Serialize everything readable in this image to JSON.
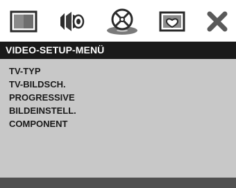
{
  "tabs": [
    {
      "icon": "tv-screen-icon"
    },
    {
      "icon": "speaker-audio-icon"
    },
    {
      "icon": "disc-icon",
      "active": true
    },
    {
      "icon": "picture-frame-icon"
    },
    {
      "icon": "close-icon"
    }
  ],
  "menu": {
    "title": "VIDEO-SETUP-MENÜ",
    "items": [
      "TV-TYP",
      "TV-BILDSCH.",
      "PROGRESSIVE",
      "BILDEINSTELL.",
      "COMPONENT"
    ]
  },
  "colors": {
    "title_bg": "#1a1a1a",
    "panel_bg": "#c8c8c8",
    "status_bg": "#505050",
    "text": "#1a1a1a"
  }
}
